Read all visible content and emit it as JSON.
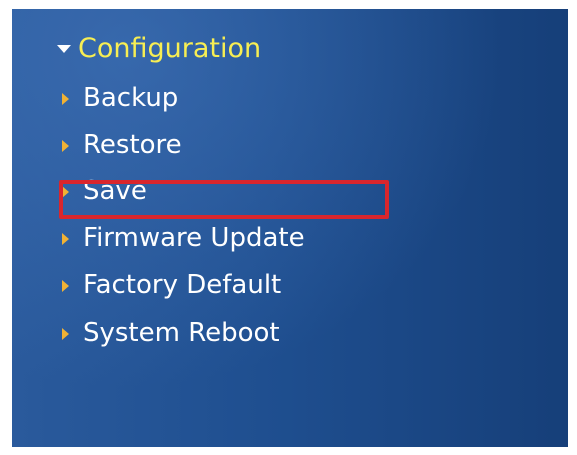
{
  "menu": {
    "header_label": "Configuration",
    "items": [
      {
        "label": "Backup"
      },
      {
        "label": "Restore"
      },
      {
        "label": "Save"
      },
      {
        "label": "Firmware Update"
      },
      {
        "label": "Factory Default"
      },
      {
        "label": "System Reboot"
      }
    ]
  },
  "highlighted_item": "Save",
  "colors": {
    "panel": "#1f4f90",
    "header_text": "#f7ee53",
    "item_text": "#ffffff",
    "item_caret": "#f1b234",
    "highlight_border": "#d9262d"
  },
  "icons": {
    "header": "chevron-down-icon",
    "item": "chevron-right-icon"
  }
}
